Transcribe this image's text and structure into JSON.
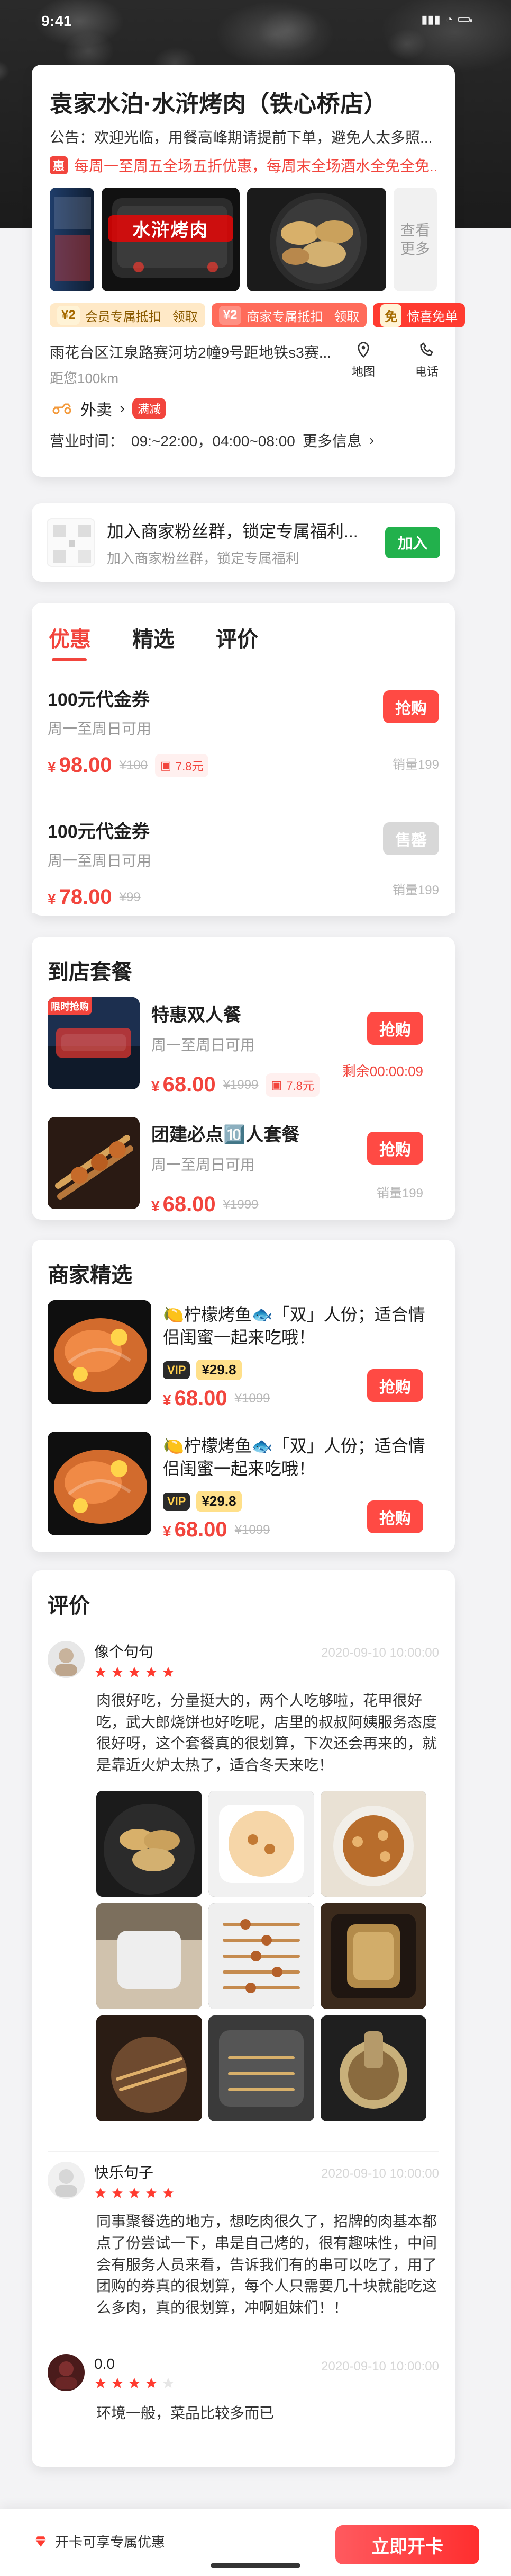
{
  "status_bar": {
    "time": "9:41"
  },
  "store": {
    "title": "袁家水泊·水浒烤肉（铁心桥店）",
    "notice": "公告：欢迎光临，用餐高峰期请提前下单，避免人太多照...",
    "promo": "每周一至周五全场五折优惠，每周末全场酒水全免全免...",
    "promo_icon": "惠",
    "gallery_more": "查看更多",
    "gallery_sign": "水浒烤肉",
    "chips": [
      {
        "value": "¥2",
        "text": "会员专属抵扣",
        "action": "领取"
      },
      {
        "value": "¥2",
        "text": "商家专属抵扣",
        "action": "领取"
      },
      {
        "value": "免",
        "text": "惊喜免单",
        "action": ""
      }
    ],
    "address": "雨花台区江泉路赛河坊2幢9号距地铁s3赛...",
    "distance": "距您100km",
    "actions": [
      {
        "label": "地图"
      },
      {
        "label": "电话"
      }
    ],
    "takeout_label": "外卖",
    "takeout_badge": "满减",
    "hours_prefix": "营业时间：",
    "hours": "09:~22:00，04:00~08:00",
    "hours_more": "更多信息"
  },
  "join": {
    "title": "加入商家粉丝群，锁定专属福利...",
    "subtitle": "加入商家粉丝群，锁定专属福利",
    "button": "加入"
  },
  "tabs": [
    {
      "label": "优惠"
    },
    {
      "label": "精选"
    },
    {
      "label": "评价"
    }
  ],
  "coupons": [
    {
      "name": "100元代金券",
      "sub": "周一至周日可用",
      "price": "98.00",
      "old": "¥100",
      "discount": "7.8元",
      "button": "抢购",
      "sold": "销量199"
    },
    {
      "name": "100元代金券",
      "sub": "周一至周日可用",
      "price": "78.00",
      "old": "¥99",
      "button": "售罄",
      "sold": "销量199"
    }
  ],
  "packages": {
    "title": "到店套餐",
    "items": [
      {
        "tag": "限时抢购",
        "name": "特惠双人餐",
        "sub": "周一至周日可用",
        "price": "68.00",
        "old": "¥1999",
        "discount": "7.8元",
        "button": "抢购",
        "countdown": "剩余00:00:09"
      },
      {
        "name": "团建必点🔟人套餐",
        "sub": "周一至周日可用",
        "price": "68.00",
        "old": "¥1999",
        "button": "抢购",
        "sold": "销量199"
      }
    ]
  },
  "picks": {
    "title": "商家精选",
    "items": [
      {
        "title": "🍋柠檬烤鱼🐟「双」人份；适合情侣闺蜜一起来吃哦！",
        "vip": "VIP",
        "vip_price": "¥29.8",
        "price": "68.00",
        "old": "¥1099",
        "button": "抢购"
      },
      {
        "title": "🍋柠檬烤鱼🐟「双」人份；适合情侣闺蜜一起来吃哦！",
        "vip": "VIP",
        "vip_price": "¥29.8",
        "price": "68.00",
        "old": "¥1099",
        "button": "抢购"
      }
    ]
  },
  "reviews": {
    "title": "评价",
    "items": [
      {
        "name": "像个句句",
        "rating": 5,
        "date": "2020-09-10 10:00:00",
        "text": "肉很好吃，分量挺大的，两个人吃够啦，花甲很好吃，武大郎烧饼也好吃呢，店里的叔叔阿姨服务态度很好呀，这个套餐真的很划算，下次还会再来的，就是靠近火炉太热了，适合冬天来吃！"
      },
      {
        "name": "快乐句子",
        "rating": 5,
        "date": "2020-09-10 10:00:00",
        "text": "同事聚餐选的地方，想吃肉很久了，招牌的肉基本都点了份尝试一下，串是自己烤的，很有趣味性，中间会有服务人员来看，告诉我们有的串可以吃了，用了团购的券真的很划算，每个人只需要几十块就能吃这么多肉，真的很划算，冲啊姐妹们！！"
      },
      {
        "name": "0.0",
        "rating": 4,
        "date": "2020-09-10 10:00:00",
        "text": "环境一般，菜品比较多而已"
      }
    ]
  },
  "bottom": {
    "left_text": "开卡可享专属优惠",
    "cta": "立即开卡"
  }
}
